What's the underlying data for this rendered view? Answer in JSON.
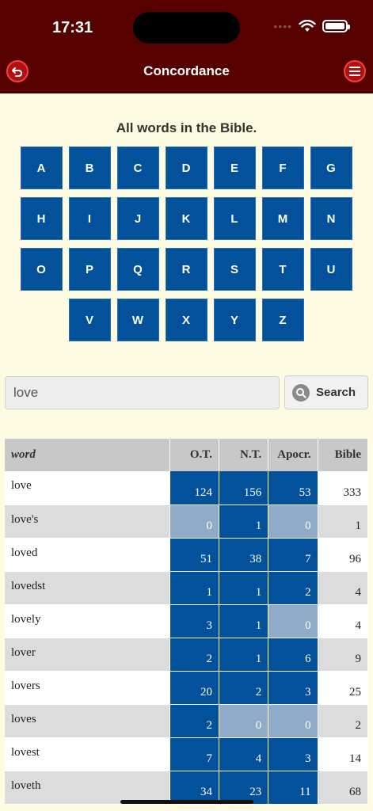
{
  "status_bar": {
    "time": "17:31",
    "cell_signal": "••••"
  },
  "nav": {
    "title": "Concordance",
    "back_icon": "back-arrow-icon",
    "menu_icon": "hamburger-menu-icon"
  },
  "subtitle": "All words in the Bible.",
  "alphabet_rows": [
    [
      "A",
      "B",
      "C",
      "D",
      "E",
      "F",
      "G"
    ],
    [
      "H",
      "I",
      "J",
      "K",
      "L",
      "M",
      "N"
    ],
    [
      "O",
      "P",
      "Q",
      "R",
      "S",
      "T",
      "U"
    ],
    [
      "V",
      "W",
      "X",
      "Y",
      "Z"
    ]
  ],
  "search": {
    "value": "love",
    "button_label": "Search"
  },
  "table": {
    "headers": {
      "word": "word",
      "ot": "O.T.",
      "nt": "N.T.",
      "apocr": "Apocr.",
      "bible": "Bible"
    },
    "rows": [
      {
        "word": "love",
        "ot": "124",
        "nt": "156",
        "apocr": "53",
        "bible": "333"
      },
      {
        "word": "love's",
        "ot": "0",
        "nt": "1",
        "apocr": "0",
        "bible": "1"
      },
      {
        "word": "loved",
        "ot": "51",
        "nt": "38",
        "apocr": "7",
        "bible": "96"
      },
      {
        "word": "lovedst",
        "ot": "1",
        "nt": "1",
        "apocr": "2",
        "bible": "4"
      },
      {
        "word": "lovely",
        "ot": "3",
        "nt": "1",
        "apocr": "0",
        "bible": "4"
      },
      {
        "word": "lover",
        "ot": "2",
        "nt": "1",
        "apocr": "6",
        "bible": "9"
      },
      {
        "word": "lovers",
        "ot": "20",
        "nt": "2",
        "apocr": "3",
        "bible": "25"
      },
      {
        "word": "loves",
        "ot": "2",
        "nt": "0",
        "apocr": "0",
        "bible": "2"
      },
      {
        "word": "lovest",
        "ot": "7",
        "nt": "4",
        "apocr": "3",
        "bible": "14"
      },
      {
        "word": "loveth",
        "ot": "34",
        "nt": "23",
        "apocr": "11",
        "bible": "68"
      }
    ]
  },
  "colors": {
    "header_bg": "#570000",
    "page_bg": "#fefbe3",
    "accent_blue": "#03519a",
    "zero_blue": "#8fabc7"
  }
}
